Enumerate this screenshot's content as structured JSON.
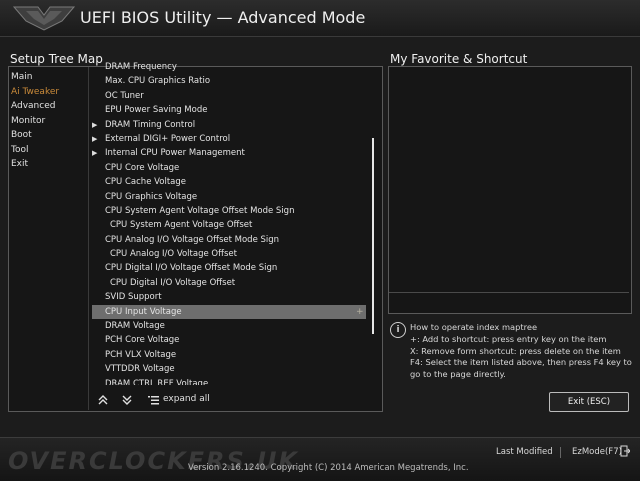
{
  "window": {
    "title": "UEFI BIOS Utility — Advanced Mode"
  },
  "left_panel": {
    "title": "Setup Tree Map",
    "nav": [
      {
        "label": "Main"
      },
      {
        "label": "Ai Tweaker",
        "active": true
      },
      {
        "label": "Advanced"
      },
      {
        "label": "Monitor"
      },
      {
        "label": "Boot"
      },
      {
        "label": "Tool"
      },
      {
        "label": "Exit"
      }
    ],
    "items": [
      {
        "label": "DRAM Frequency",
        "indent": 0,
        "arrow": false
      },
      {
        "label": "Max. CPU Graphics Ratio",
        "indent": 0,
        "arrow": false
      },
      {
        "label": "OC Tuner",
        "indent": 0,
        "arrow": false
      },
      {
        "label": "EPU Power Saving Mode",
        "indent": 0,
        "arrow": false
      },
      {
        "label": "DRAM Timing Control",
        "indent": 0,
        "arrow": true
      },
      {
        "label": "External DIGI+ Power Control",
        "indent": 0,
        "arrow": true
      },
      {
        "label": "Internal CPU Power Management",
        "indent": 0,
        "arrow": true
      },
      {
        "label": "CPU Core Voltage",
        "indent": 0,
        "arrow": false
      },
      {
        "label": "CPU Cache Voltage",
        "indent": 0,
        "arrow": false
      },
      {
        "label": "CPU Graphics Voltage",
        "indent": 0,
        "arrow": false
      },
      {
        "label": "CPU System Agent Voltage Offset Mode Sign",
        "indent": 0,
        "arrow": false
      },
      {
        "label": "CPU System Agent Voltage Offset",
        "indent": 1,
        "arrow": false
      },
      {
        "label": "CPU Analog I/O Voltage Offset Mode Sign",
        "indent": 0,
        "arrow": false
      },
      {
        "label": "CPU Analog I/O Voltage Offset",
        "indent": 1,
        "arrow": false
      },
      {
        "label": "CPU Digital I/O Voltage Offset Mode Sign",
        "indent": 0,
        "arrow": false
      },
      {
        "label": "CPU Digital I/O Voltage Offset",
        "indent": 1,
        "arrow": false
      },
      {
        "label": "SVID Support",
        "indent": 0,
        "arrow": false
      },
      {
        "label": "CPU Input Voltage",
        "indent": 0,
        "arrow": false,
        "selected": true
      },
      {
        "label": "DRAM Voltage",
        "indent": 0,
        "arrow": false
      },
      {
        "label": "PCH Core Voltage",
        "indent": 0,
        "arrow": false
      },
      {
        "label": "PCH VLX Voltage",
        "indent": 0,
        "arrow": false
      },
      {
        "label": "VTTDDR Voltage",
        "indent": 0,
        "arrow": false
      },
      {
        "label": "DRAM CTRL REF Voltage",
        "indent": 0,
        "arrow": false
      }
    ],
    "expand_label": "expand all"
  },
  "right_panel": {
    "title": "My Favorite & Shortcut",
    "info_icon": "i",
    "info_lines": [
      "How to operate index maptree",
      "+: Add to shortcut: press entry key on the item",
      "X: Remove form shortcut: press delete on the item",
      "F4: Select the item listed above, then press F4 key to go to the page directly."
    ],
    "exit_label": "Exit (ESC)"
  },
  "footer": {
    "last_modified": "Last Modified",
    "ezmode": "EzMode(F7)",
    "copyright": "Version 2.16.1240. Copyright (C) 2014 American Megatrends, Inc.",
    "watermark": "OVERCLOCKERS.UK"
  },
  "colors": {
    "accent": "#c98a3a",
    "selected_row": "#6e6e6e"
  }
}
